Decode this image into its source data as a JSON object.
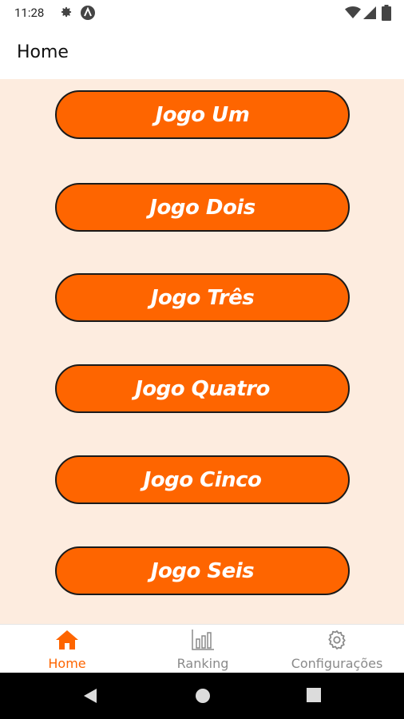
{
  "status_bar": {
    "time": "11:28",
    "icons": [
      "gear-icon",
      "a-icon",
      "wifi-icon",
      "signal-icon",
      "battery-icon"
    ]
  },
  "app_bar": {
    "title": "Home"
  },
  "games": [
    {
      "label": "Jogo Um"
    },
    {
      "label": "Jogo Dois"
    },
    {
      "label": "Jogo Três"
    },
    {
      "label": "Jogo Quatro"
    },
    {
      "label": "Jogo Cinco"
    },
    {
      "label": "Jogo Seis"
    }
  ],
  "bottom_nav": {
    "items": [
      {
        "label": "Home",
        "icon": "home-icon",
        "active": true
      },
      {
        "label": "Ranking",
        "icon": "bar-chart-icon",
        "active": false
      },
      {
        "label": "Configurações",
        "icon": "gear-icon",
        "active": false
      }
    ]
  },
  "system_nav": {
    "icons": [
      "back-icon",
      "home-circle-icon",
      "recents-icon"
    ]
  },
  "colors": {
    "accent": "#fe6500",
    "content_background": "#fdecdf",
    "button_border": "#1a1a1a",
    "inactive": "#8a8a8a"
  }
}
